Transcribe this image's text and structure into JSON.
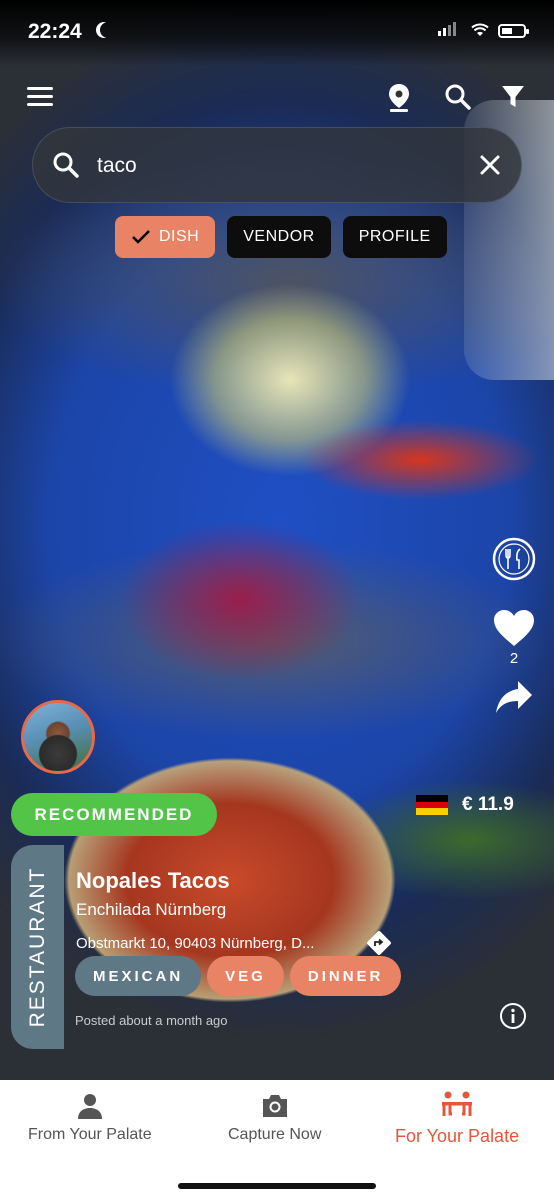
{
  "status_bar": {
    "time": "22:24"
  },
  "search": {
    "query": "taco",
    "placeholder": ""
  },
  "search_type_chips": [
    {
      "label": "DISH",
      "selected": true
    },
    {
      "label": "VENDOR",
      "selected": false
    },
    {
      "label": "PROFILE",
      "selected": false
    }
  ],
  "post": {
    "likes": "2",
    "recommendation_badge": "RECOMMENDED",
    "vendor_type": "RESTAURANT",
    "dish_name": "Nopales Tacos",
    "vendor_name": "Enchilada Nürnberg",
    "address": "Obstmarkt 10, 90403 Nürnberg, D...",
    "price": "€ 11.9",
    "country_flag": "germany-flag",
    "tags": [
      "MEXICAN",
      "VEG",
      "DINNER"
    ],
    "posted": "Posted about a month ago"
  },
  "bottom_nav": [
    {
      "label": "From Your Palate",
      "icon": "person-icon",
      "active": false
    },
    {
      "label": "Capture Now",
      "icon": "camera-icon",
      "active": false
    },
    {
      "label": "For Your Palate",
      "icon": "two-people-table-icon",
      "active": true
    }
  ],
  "colors": {
    "accent_orange": "#e98365",
    "active_nav": "#e8553a",
    "recommended_green": "#52c548",
    "tag_slate": "#5f7886"
  }
}
